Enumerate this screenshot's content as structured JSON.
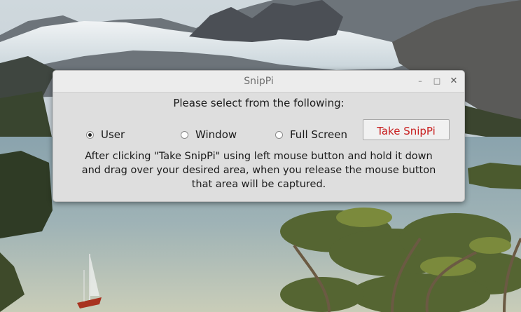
{
  "window": {
    "title": "SnipPi",
    "controls": {
      "minimize": "–",
      "maximize": "□",
      "close": "✕"
    }
  },
  "dialog": {
    "prompt": "Please select from the following:",
    "options": [
      {
        "label": "User",
        "checked": true
      },
      {
        "label": "Window",
        "checked": false
      },
      {
        "label": "Full Screen",
        "checked": false
      }
    ],
    "take_button_label": "Take SnipPi",
    "instructions": "After clicking \"Take SnipPi\" using left mouse button and hold it down and drag over your desired area, when you release the mouse button that area will be captured."
  },
  "colors": {
    "take_button_text": "#c82020",
    "window_bg": "#dedede"
  }
}
